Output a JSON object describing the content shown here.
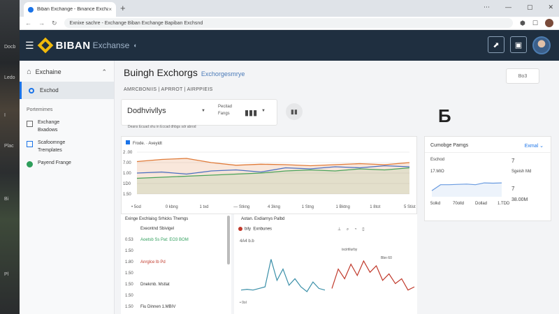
{
  "browser": {
    "tab_title": "Biban Exchange - Binance Exchange",
    "tab_close": "×",
    "new_tab": "+",
    "window_controls": [
      "⋯",
      "—",
      "▢",
      "✕"
    ],
    "url": "Exnixe sachre - Exchange Biban Exchange Bapiban Exchsnd",
    "nav": [
      "←",
      "→",
      "↻"
    ],
    "ext_icons": [
      "⬢",
      "☐"
    ]
  },
  "desktop": {
    "labels": [
      "Docb",
      "Ledo",
      "I",
      "Plac",
      "Bi",
      "Pl"
    ]
  },
  "appbar": {
    "menu_icon": "☰",
    "brand": "BIBAN",
    "brand_sub": "Exchanse",
    "brand_icon": "◐",
    "right_buttons": [
      "⬈",
      "▣"
    ]
  },
  "sidebar": {
    "header": "Exchaine",
    "header_icon": "⌂",
    "header_chevron": "⌃",
    "active_item": "Exchod",
    "section": "Portemimes",
    "items": [
      {
        "line1": "Exchange",
        "line2": "Bxadows"
      },
      {
        "line1": "Scafoomnge",
        "line2": "Tremplates"
      },
      {
        "line1": "Payend Frange",
        "line2": ""
      }
    ]
  },
  "main": {
    "title": "Buingh Exchorgs",
    "title_sub": "Exchorgesmrye",
    "top_right_button": "Bo3",
    "breadcrumbs": "AMRCBONIIS  |  APRROT  |  AIRPPIEIS",
    "filter": {
      "select_value": "Dodhvivllys",
      "label_line1": "Pecitad",
      "label_line2": "Fangs",
      "bar_icon": "▮▮▮",
      "caret": "▼",
      "round_button": "▮▮"
    },
    "filter_note": "Deans Ecuad shu in Eccad dhbgs sdr abrod",
    "big_glyph": "Ƃ",
    "main_card": {
      "title": "Frode. · Aveyidt",
      "y_ticks": [
        "2 .00",
        "7.00",
        "1.00",
        "1D0",
        "1.50"
      ],
      "x_ticks": [
        "• 5od",
        "0 kbng",
        "1 txd",
        "— Stkng",
        "4 3kng",
        "1 Stng",
        "1 Bktng",
        "1 8tot",
        "5 Stist"
      ]
    },
    "side_card": {
      "title": "Cumobge Pamgs",
      "link": "Exmal ⌄",
      "label_a": "Eschod",
      "value_a": "7",
      "label_b": "17.MIO",
      "value_b": "Sgeish Md",
      "value_c": "7",
      "value_d": "38.00M",
      "x_ticks": [
        "5olkd",
        "70olld",
        "Dollad",
        "1.TDD"
      ]
    },
    "lower_left": {
      "title": "Exinge Exchlaisg Srhicks Themgs",
      "rows": [
        {
          "num": "",
          "text": "Exeontnd Sbivigel",
          "cls": ""
        },
        {
          "num": "0.53",
          "text": "Aoetsb Ss Pat: EO3 BOM",
          "cls": "g"
        },
        {
          "num": "1.50",
          "text": "",
          "cls": ""
        },
        {
          "num": "1.80",
          "text": "Anrglce lb Pd",
          "cls": "r"
        },
        {
          "num": "1.50",
          "text": "",
          "cls": ""
        },
        {
          "num": "1.50",
          "text": "Dnekmb. Mstlat",
          "cls": ""
        },
        {
          "num": "1.50",
          "text": "",
          "cls": ""
        },
        {
          "num": "1.50",
          "text": "Fiu Dinnen 1.MBIV",
          "cls": ""
        }
      ]
    },
    "lower_right": {
      "title": "Aotan. Exdiarnys Palbd",
      "legend_a": "bily",
      "legend_b": "Exnbunes",
      "tools": "⊥ ⌕ ◔ ▯",
      "y_label": "4A4 b.b",
      "ann1": "iscirtilurby",
      "ann2": "Bbn 60",
      "tick": "• 0ol"
    }
  },
  "chart_data": [
    {
      "type": "area",
      "title": "Frode. · Aveyidt",
      "x": [
        "• 5od",
        "0 kbng",
        "1 txd",
        "— Stkng",
        "4 3kng",
        "1 Stng",
        "1 Bktng",
        "1 8tot",
        "5 Stist"
      ],
      "y_ticks": [
        "2 .00",
        "7.00",
        "1.00",
        "1D0",
        "1.50"
      ],
      "series": [
        {
          "color": "#e07b39",
          "values": [
            62,
            66,
            68,
            60,
            55,
            57,
            56,
            54,
            56,
            58,
            56,
            60
          ]
        },
        {
          "color": "#4a6fc1",
          "values": [
            40,
            42,
            38,
            44,
            46,
            42,
            50,
            48,
            52,
            50,
            54,
            52
          ]
        },
        {
          "color": "#4aa35a",
          "values": [
            30,
            32,
            34,
            36,
            38,
            40,
            44,
            46,
            44,
            48,
            46,
            50
          ]
        }
      ]
    },
    {
      "type": "line",
      "title": "Cumobge Pamgs",
      "x": [
        "5olkd",
        "70olld",
        "Dollad",
        "1.TDD"
      ],
      "series": [
        {
          "color": "#6a9be0",
          "values": [
            20,
            40,
            40,
            41,
            42,
            40,
            46,
            45,
            46
          ]
        }
      ]
    },
    {
      "type": "line",
      "title": "Aotan. Exdiarnys Palbd",
      "series": [
        {
          "name": "bily",
          "color": "#3a8fa8",
          "values": [
            8,
            9,
            8,
            10,
            12,
            46,
            20,
            34,
            14,
            22,
            12,
            6,
            18,
            10,
            8
          ]
        },
        {
          "name": "Exnbunes",
          "color": "#c0392b",
          "values": [
            10,
            34,
            22,
            40,
            26,
            44,
            30,
            38,
            20,
            28,
            16,
            22,
            8,
            12
          ]
        }
      ]
    }
  ],
  "colors": {
    "accent": "#1a73e8",
    "brand": "#f0b90b",
    "appbar": "#1f2f40"
  }
}
